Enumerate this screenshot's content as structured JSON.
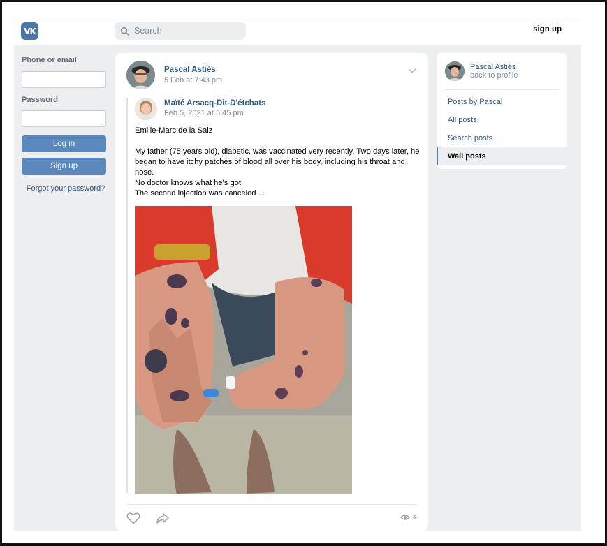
{
  "header": {
    "logo_text": "VK",
    "search_placeholder": "Search",
    "signup_label": "sign up"
  },
  "login": {
    "phone_label": "Phone or email",
    "password_label": "Password",
    "login_button": "Log in",
    "signup_button": "Sign up",
    "forgot_link": "Forgot your password?"
  },
  "post": {
    "author": "Pascal Astiés",
    "date": "5 Feb at 7:43 pm",
    "repost": {
      "author": "Maïté Arsacq-Dit-D'étchats",
      "date": "Feb 5, 2021 at 5:45 pm",
      "text": {
        "line1": "Emilie-Marc de la Salz",
        "para1": "My father (75 years old), diabetic, was vaccinated very recently. Two days later, he began to have itchy patches of blood all over his body, including his throat and nose.",
        "line2": "No doctor knows what he's got.",
        "line3": "The second injection was canceled ..."
      }
    },
    "views": "4"
  },
  "sidebar": {
    "profile_name": "Pascal Astiés",
    "back_label": "back to profile",
    "items": [
      {
        "label": "Posts by Pascal",
        "active": false
      },
      {
        "label": "All posts",
        "active": false
      },
      {
        "label": "Search posts",
        "active": false
      },
      {
        "label": "Wall posts",
        "active": true
      }
    ]
  },
  "colors": {
    "accent": "#5b88bd",
    "link": "#2a5885",
    "background": "#edeef0"
  },
  "icons": [
    "vk-logo-icon",
    "search-icon",
    "chevron-down-icon",
    "heart-icon",
    "share-icon",
    "eye-icon"
  ]
}
